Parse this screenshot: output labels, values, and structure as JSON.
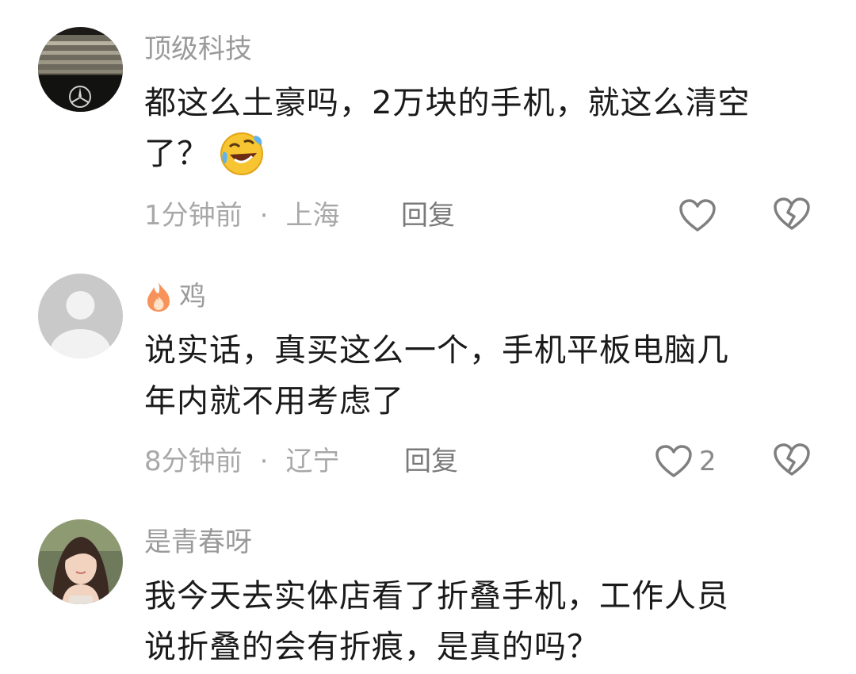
{
  "comments": [
    {
      "username": "顶级科技",
      "text_line1": "都这么土豪吗，2万块的手机，就这么清空",
      "text_line2": "了？",
      "time": "1分钟前",
      "separator": "·",
      "location": "上海",
      "reply_label": "回复",
      "like_count": "",
      "avatar_icon": "car-grille-avatar",
      "emoji_icon": "rolling-laughing-emoji"
    },
    {
      "username": "鸡",
      "username_prefix_icon": "fire-icon",
      "text_line1": "说实话，真买这么一个，手机平板电脑几",
      "text_line2": "年内就不用考虑了",
      "time": "8分钟前",
      "separator": "·",
      "location": "辽宁",
      "reply_label": "回复",
      "like_count": "2",
      "avatar_icon": "default-user-avatar"
    },
    {
      "username": "是青春呀",
      "text_line1": "我今天去实体店看了折叠手机，工作人员",
      "text_line2": "说折叠的会有折痕，是真的吗？",
      "avatar_icon": "girl-photo-avatar"
    }
  ],
  "colors": {
    "text": "#1a1a1a",
    "username": "#9a9a9a",
    "meta": "#a8a8a8",
    "icon_stroke": "#7f7f7f"
  }
}
